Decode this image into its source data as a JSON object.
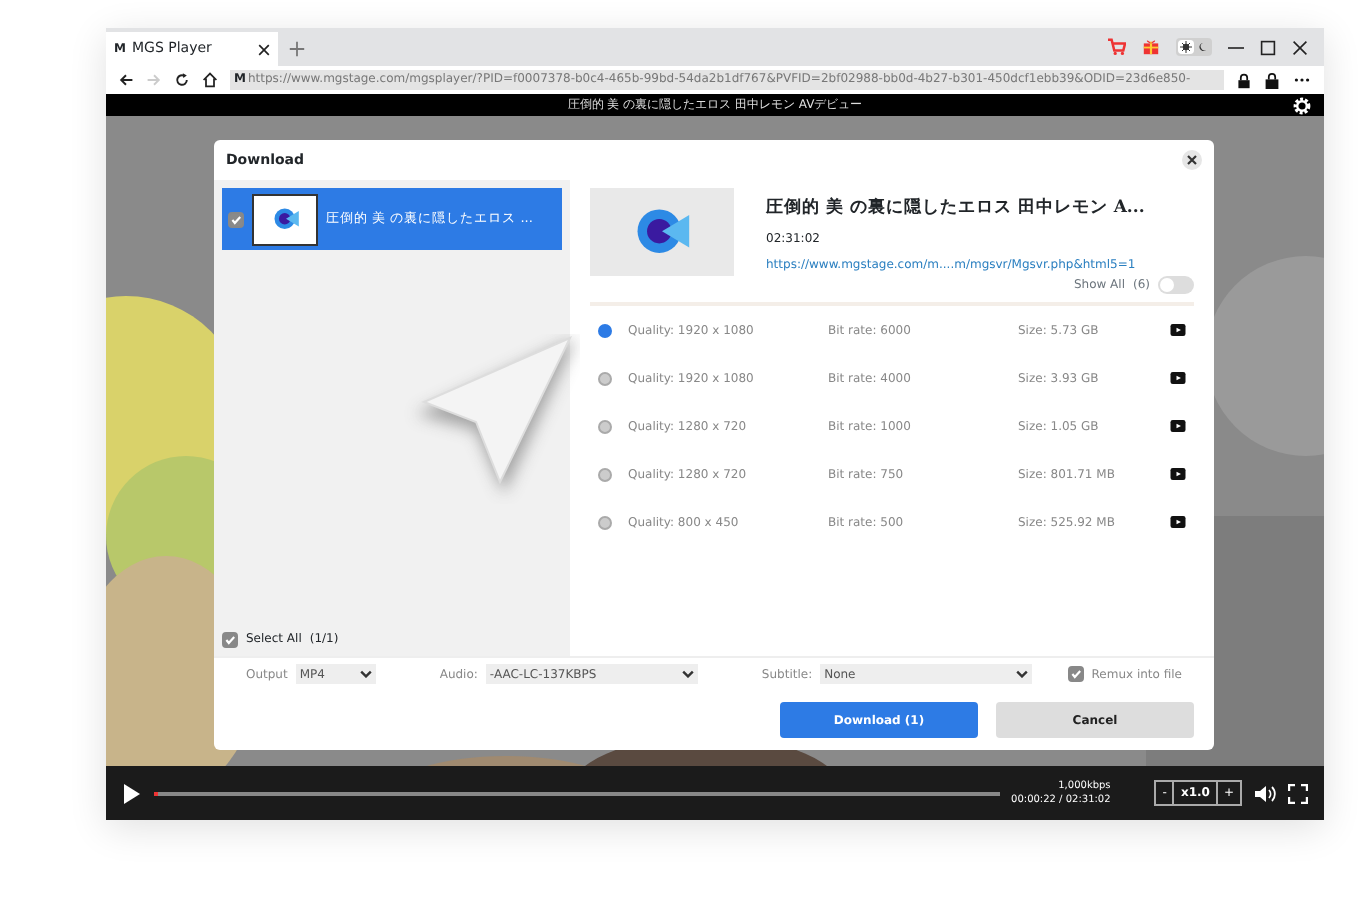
{
  "browser": {
    "tab": {
      "favicon": "M",
      "title": "MGS Player"
    },
    "address": {
      "favicon": "M",
      "url": "https://www.mgstage.com/mgsplayer/?PID=f0007378-b0c4-465b-99bd-54da2b1df767&PVFID=2bf02988-bb0d-4b27-b301-450dcf1ebb39&ODID=23d6e850-"
    }
  },
  "player": {
    "title": "圧倒的 美 の裏に隠したエロス 田中レモン AVデビュー",
    "bitrate": "1,000kbps",
    "time": "00:00:22 / 02:31:02",
    "level": 0.003,
    "speed_minus": "-",
    "speed": "x1.0",
    "speed_plus": "+"
  },
  "dialog": {
    "title": "Download",
    "items": [
      {
        "title": "圧倒的 美 の裏に隠したエロス ...",
        "checked": true,
        "selected": true
      }
    ],
    "select_all": {
      "label": "Select All",
      "count": "(1/1)",
      "checked": true
    },
    "detail": {
      "title": "圧倒的 美 の裏に隠したエロス 田中レモン A...",
      "duration": "02:31:02",
      "url": "https://www.mgstage.com/m....m/mgsvr/Mgsvr.php&html5=1",
      "show_all": {
        "label": "Show All",
        "count": "(6)",
        "on": false
      }
    },
    "formats": [
      {
        "quality": "Quality: 1920 x 1080",
        "bitrate": "Bit rate: 6000",
        "size": "Size: 5.73 GB",
        "selected": true
      },
      {
        "quality": "Quality: 1920 x 1080",
        "bitrate": "Bit rate: 4000",
        "size": "Size: 3.93 GB",
        "selected": false
      },
      {
        "quality": "Quality: 1280 x 720",
        "bitrate": "Bit rate: 1000",
        "size": "Size: 1.05 GB",
        "selected": false
      },
      {
        "quality": "Quality: 1280 x 720",
        "bitrate": "Bit rate: 750",
        "size": "Size: 801.71 MB",
        "selected": false
      },
      {
        "quality": "Quality: 800 x 450",
        "bitrate": "Bit rate: 500",
        "size": "Size: 525.92 MB",
        "selected": false
      }
    ],
    "options": {
      "output": {
        "label": "Output",
        "value": "MP4"
      },
      "audio": {
        "label": "Audio:",
        "value": "-AAC-LC-137KBPS"
      },
      "subtitle": {
        "label": "Subtitle:",
        "value": "None"
      },
      "remux": {
        "label": "Remux into file",
        "checked": true
      }
    },
    "buttons": {
      "download": "Download (1)",
      "cancel": "Cancel"
    }
  }
}
